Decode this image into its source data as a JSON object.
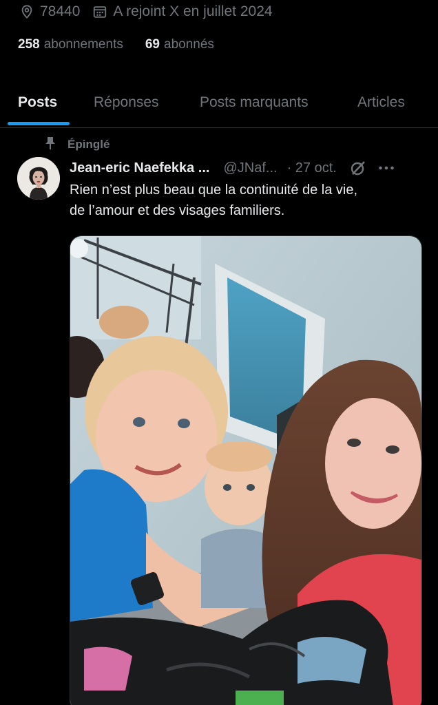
{
  "profile": {
    "location": "78440",
    "joined": "A rejoint X en juillet 2024",
    "following_count": "258",
    "following_label": "abonnements",
    "followers_count": "69",
    "followers_label": "abonnés"
  },
  "tabs": [
    {
      "label": "Posts",
      "active": true
    },
    {
      "label": "Réponses",
      "active": false
    },
    {
      "label": "Posts marquants",
      "active": false
    },
    {
      "label": "Articles",
      "active": false
    }
  ],
  "post": {
    "pinned_label": "Épinglé",
    "author_name": "Jean-eric Naefekka ...",
    "author_handle": "@JNaf...",
    "date": "· 27 oct.",
    "text_line1": "Rien n’est plus beau que la continuité de la vie,",
    "text_line2": "de l’amour et des visages familiers."
  },
  "colors": {
    "background": "#000000",
    "primary_text": "#e7e9ea",
    "secondary_text": "#71767b",
    "accent": "#1d9bf0",
    "divider": "#2f3336"
  },
  "icons": [
    "location-pin-icon",
    "calendar-icon",
    "pin-icon",
    "grok-icon",
    "more-icon"
  ]
}
